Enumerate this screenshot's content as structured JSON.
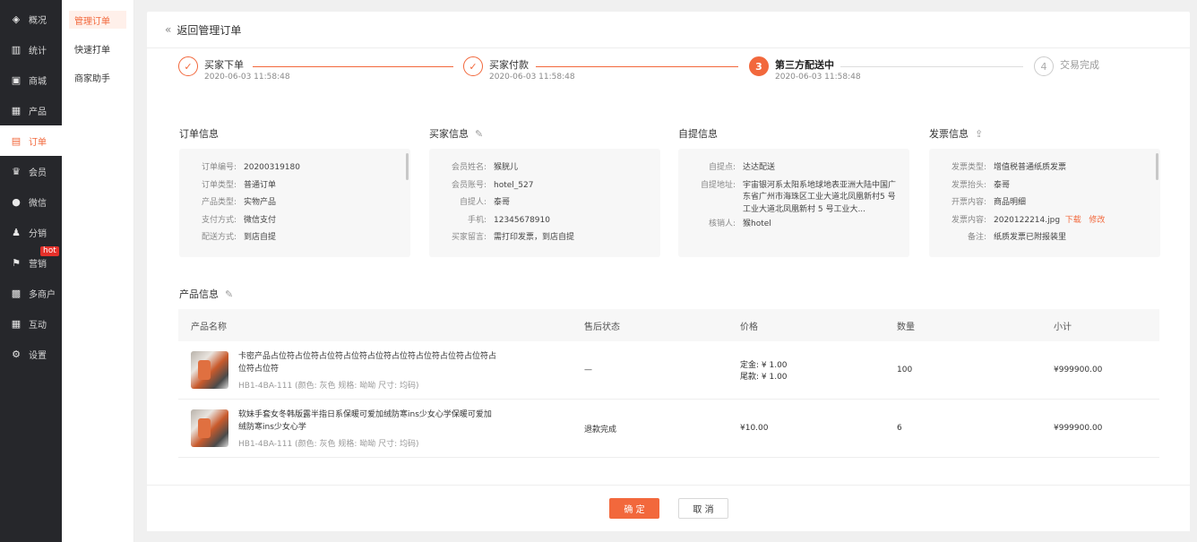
{
  "nav": {
    "items": [
      {
        "label": "概况",
        "icon": "layers-icon",
        "glyph": "◈"
      },
      {
        "label": "统计",
        "icon": "bar-chart-icon",
        "glyph": "▥"
      },
      {
        "label": "商城",
        "icon": "shop-icon",
        "glyph": "▣"
      },
      {
        "label": "产品",
        "icon": "grid-icon",
        "glyph": "▦"
      },
      {
        "label": "订单",
        "icon": "order-icon",
        "glyph": "▤"
      },
      {
        "label": "会员",
        "icon": "crown-icon",
        "glyph": "♛"
      },
      {
        "label": "微信",
        "icon": "wechat-icon",
        "glyph": "●"
      },
      {
        "label": "分销",
        "icon": "user-share-icon",
        "glyph": "♟"
      },
      {
        "label": "营销",
        "icon": "flag-icon",
        "glyph": "⚑",
        "badge": "hot"
      },
      {
        "label": "多商户",
        "icon": "merchant-icon",
        "glyph": "▩"
      },
      {
        "label": "互动",
        "icon": "interact-icon",
        "glyph": "▦"
      },
      {
        "label": "设置",
        "icon": "gear-icon",
        "glyph": "⚙"
      }
    ]
  },
  "subnav": {
    "items": [
      "管理订单",
      "快速打单",
      "商家助手"
    ]
  },
  "back": {
    "label": "返回管理订单"
  },
  "steps": [
    {
      "title": "买家下单",
      "time": "2020-06-03 11:58:48",
      "mark": "✓"
    },
    {
      "title": "买家付款",
      "time": "2020-06-03 11:58:48",
      "mark": "✓"
    },
    {
      "title": "第三方配送中",
      "time": "2020-06-03 11:58:48",
      "mark": "3"
    },
    {
      "title": "交易完成",
      "time": "",
      "mark": "4"
    }
  ],
  "sections": {
    "order": {
      "title": "订单信息",
      "rows": [
        {
          "k": "订单编号:",
          "v": "20200319180"
        },
        {
          "k": "订单类型:",
          "v": "普通订单"
        },
        {
          "k": "产品类型:",
          "v": "实物产品"
        },
        {
          "k": "支付方式:",
          "v": "微信支付"
        },
        {
          "k": "配送方式:",
          "v": "到店自提"
        }
      ]
    },
    "buyer": {
      "title": "买家信息",
      "rows": [
        {
          "k": "会员姓名:",
          "v": "猴胱儿"
        },
        {
          "k": "会员账号:",
          "v": "hotel_527"
        },
        {
          "k": "自提人:",
          "v": "泰哥"
        },
        {
          "k": "手机:",
          "v": "12345678910"
        },
        {
          "k": "买家留言:",
          "v": "需打印发票，到店自提"
        }
      ]
    },
    "pickup": {
      "title": "自提信息",
      "point_k": "自提点:",
      "point_v": "达达配送",
      "addr_k": "自提地址:",
      "addr_v": "宇宙银河系太阳系地球地表亚洲大陆中国广东省广州市海珠区工业大道北凤凰新村5 号工业大道北凤凰新村 5 号工业大...",
      "staff_k": "核销人:",
      "staff_v": "猴hotel"
    },
    "invoice": {
      "title": "发票信息",
      "rows": [
        {
          "k": "发票类型:",
          "v": "增值税普通纸质发票"
        },
        {
          "k": "发票抬头:",
          "v": "泰哥"
        },
        {
          "k": "开票内容:",
          "v": "商品明细"
        }
      ],
      "content_k": "发票内容:",
      "content_v": "2020122214.jpg",
      "download": "下载",
      "edit": "修改",
      "note_k": "备注:",
      "note_v": "纸质发票已附报装里"
    }
  },
  "products": {
    "title": "产品信息",
    "headers": [
      "产品名称",
      "售后状态",
      "价格",
      "数量",
      "小计"
    ],
    "rows": [
      {
        "name": "卡密产品占位符占位符占位符占位符占位符占位符占位符占位符占位符占位符占位符",
        "spec": "HB1-4BA-111 (颜色: 灰色   规格: 呦呦   尺寸: 均码)",
        "status": "—",
        "price1": "定金: ¥ 1.00",
        "price2": "尾款: ¥ 1.00",
        "qty": "100",
        "subtotal": "¥999900.00"
      },
      {
        "name": "软妹手套女冬韩版露半指日系保暖可爱加绒防寒ins少女心学保暖可爱加绒防寒ins少女心学",
        "spec": "HB1-4BA-111 (颜色: 灰色   规格: 呦呦   尺寸: 均码)",
        "status": "退款完成",
        "price1": "¥10.00",
        "price2": "",
        "qty": "6",
        "subtotal": "¥999900.00"
      }
    ]
  },
  "footer": {
    "ok": "确 定",
    "cancel": "取 消"
  }
}
